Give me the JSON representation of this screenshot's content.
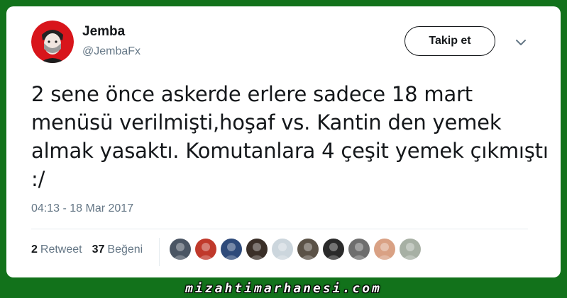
{
  "tweet": {
    "author": {
      "name": "Jemba",
      "handle": "@JembaFx"
    },
    "follow_label": "Takip et",
    "text": "2 sene önce askerde erlere sadece 18 mart menüsü verilmişti,hoşaf vs. Kantin den yemek almak yasaktı. Komutanlara 4 çeşit yemek çıkmıştı :/",
    "timestamp": "04:13 - 18 Mar 2017",
    "retweet_count": "2",
    "retweet_label": "Retweet",
    "like_count": "37",
    "like_label": "Beğeni"
  },
  "likers": [
    {
      "color": "#4a5563"
    },
    {
      "color": "#c0392b"
    },
    {
      "color": "#2e4a7a"
    },
    {
      "color": "#3a2f28"
    },
    {
      "color": "#ccd6dd"
    },
    {
      "color": "#5b5247"
    },
    {
      "color": "#2a2a2a"
    },
    {
      "color": "#6e6e6e"
    },
    {
      "color": "#d9a184"
    },
    {
      "color": "#a7b0a4"
    }
  ],
  "watermark": "mizahtimarhanesi.com",
  "colors": {
    "background": "#12721b",
    "card": "#ffffff",
    "text": "#14171a",
    "muted": "#657786",
    "avatar_bg": "#d8151b"
  }
}
